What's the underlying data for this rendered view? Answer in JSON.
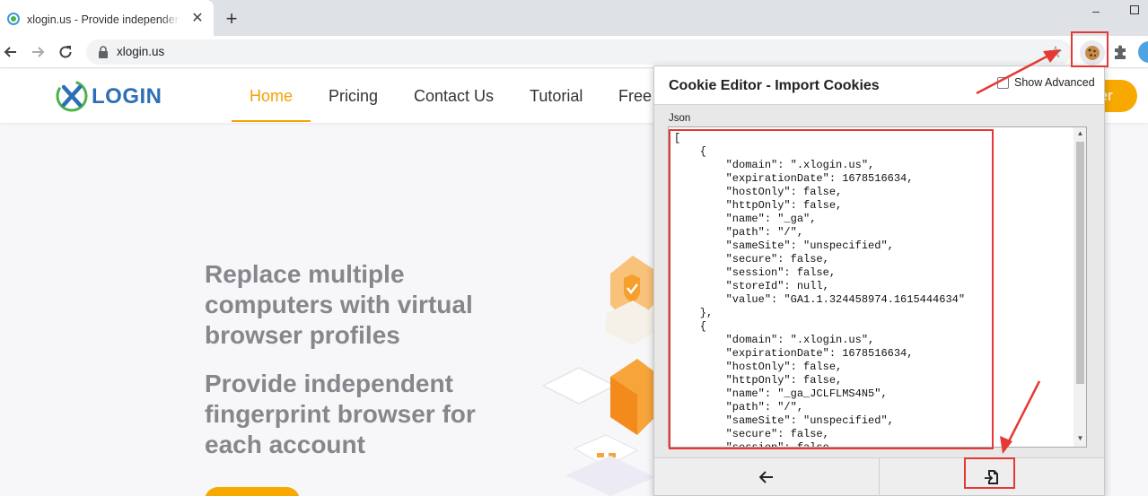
{
  "browser": {
    "tab_title": "xlogin.us - Provide independent fingerprint browser",
    "tab_close": "✕",
    "new_tab": "+",
    "url": "xlogin.us",
    "star": "☆",
    "minimize": "–"
  },
  "site": {
    "logo_text": "LOGIN",
    "nav": [
      "Home",
      "Pricing",
      "Contact Us",
      "Tutorial",
      "Free"
    ],
    "header_button": "ter",
    "hero_line1": "Replace multiple computers with virtual browser profiles",
    "hero_line2": "Provide independent fingerprint browser for each account"
  },
  "popup": {
    "title": "Cookie Editor - Import Cookies",
    "show_advanced_label": "Show Advanced",
    "show_advanced_checked": false,
    "json_label": "Json",
    "json_text": "[\n    {\n        \"domain\": \".xlogin.us\",\n        \"expirationDate\": 1678516634,\n        \"hostOnly\": false,\n        \"httpOnly\": false,\n        \"name\": \"_ga\",\n        \"path\": \"/\",\n        \"sameSite\": \"unspecified\",\n        \"secure\": false,\n        \"session\": false,\n        \"storeId\": null,\n        \"value\": \"GA1.1.324458974.1615444634\"\n    },\n    {\n        \"domain\": \".xlogin.us\",\n        \"expirationDate\": 1678516634,\n        \"hostOnly\": false,\n        \"httpOnly\": false,\n        \"name\": \"_ga_JCLFLMS4N5\",\n        \"path\": \"/\",\n        \"sameSite\": \"unspecified\",\n        \"secure\": false,\n        \"session\": false,",
    "scroll_up": "▲",
    "scroll_down": "▼"
  },
  "colors": {
    "accent": "#f5a100",
    "annotation_red": "#e53935",
    "logo_blue": "#2c6fb7"
  }
}
